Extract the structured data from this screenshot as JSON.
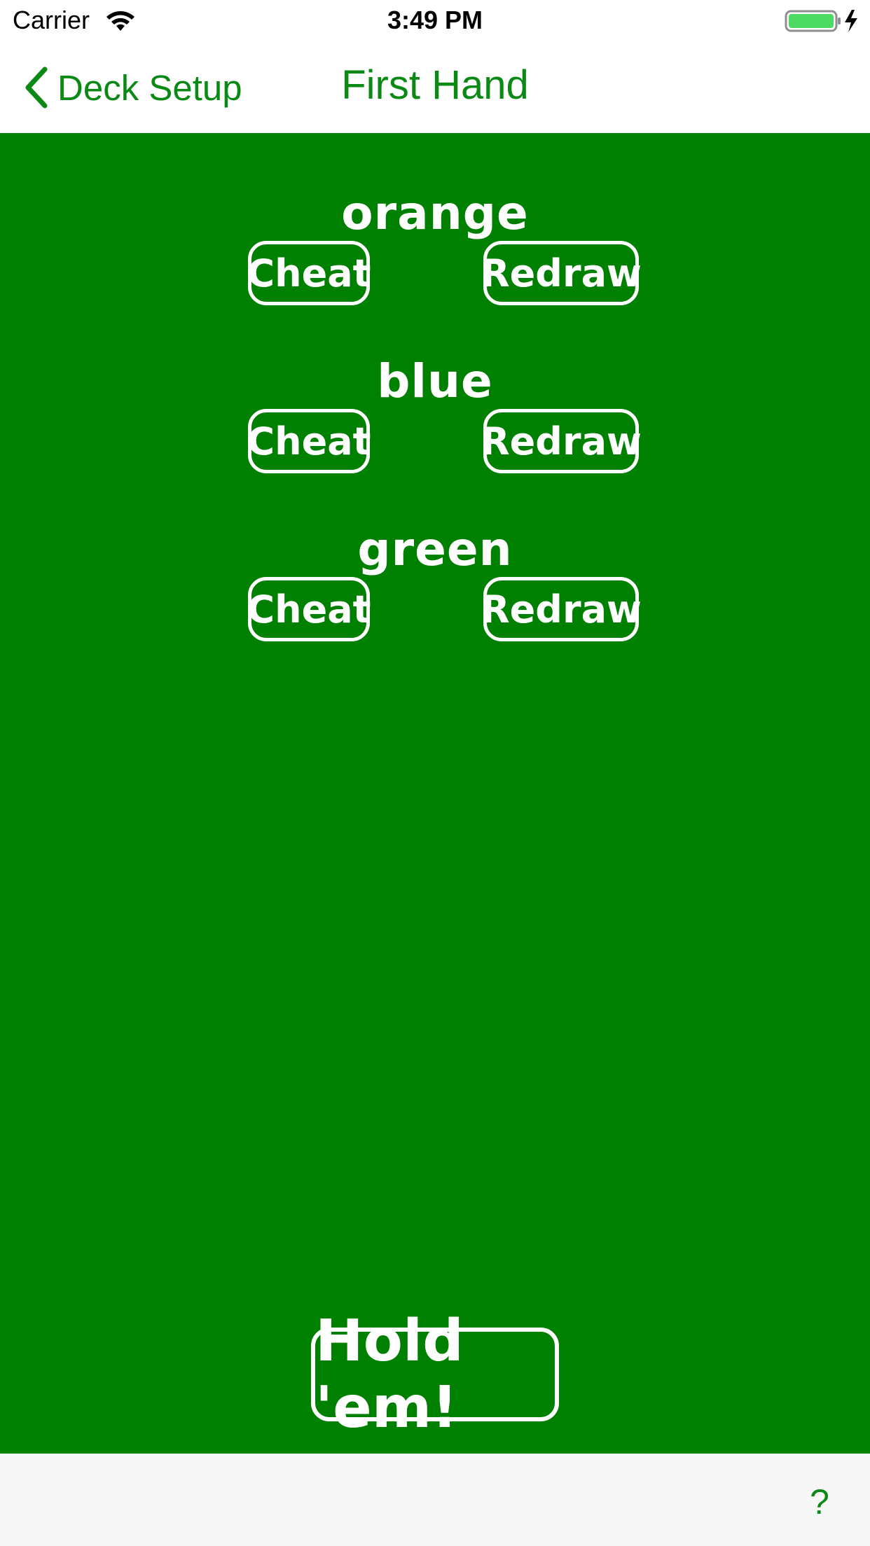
{
  "status_bar": {
    "carrier": "Carrier",
    "time": "3:49 PM",
    "wifi_icon": "wifi-icon",
    "battery_icon": "battery-charging-icon",
    "battery_color": "#4cd964"
  },
  "nav": {
    "back_label": "Deck Setup",
    "back_icon": "chevron-left-icon",
    "title": "First Hand",
    "tint_color": "#0a8a14"
  },
  "table": {
    "background": "#008000",
    "players": [
      {
        "name": "orange",
        "cheat_label": "Cheat",
        "redraw_label": "Redraw"
      },
      {
        "name": "blue",
        "cheat_label": "Cheat",
        "redraw_label": "Redraw"
      },
      {
        "name": "green",
        "cheat_label": "Cheat",
        "redraw_label": "Redraw"
      }
    ],
    "hold_label": "Hold 'em!"
  },
  "toolbar": {
    "help_label": "?"
  }
}
